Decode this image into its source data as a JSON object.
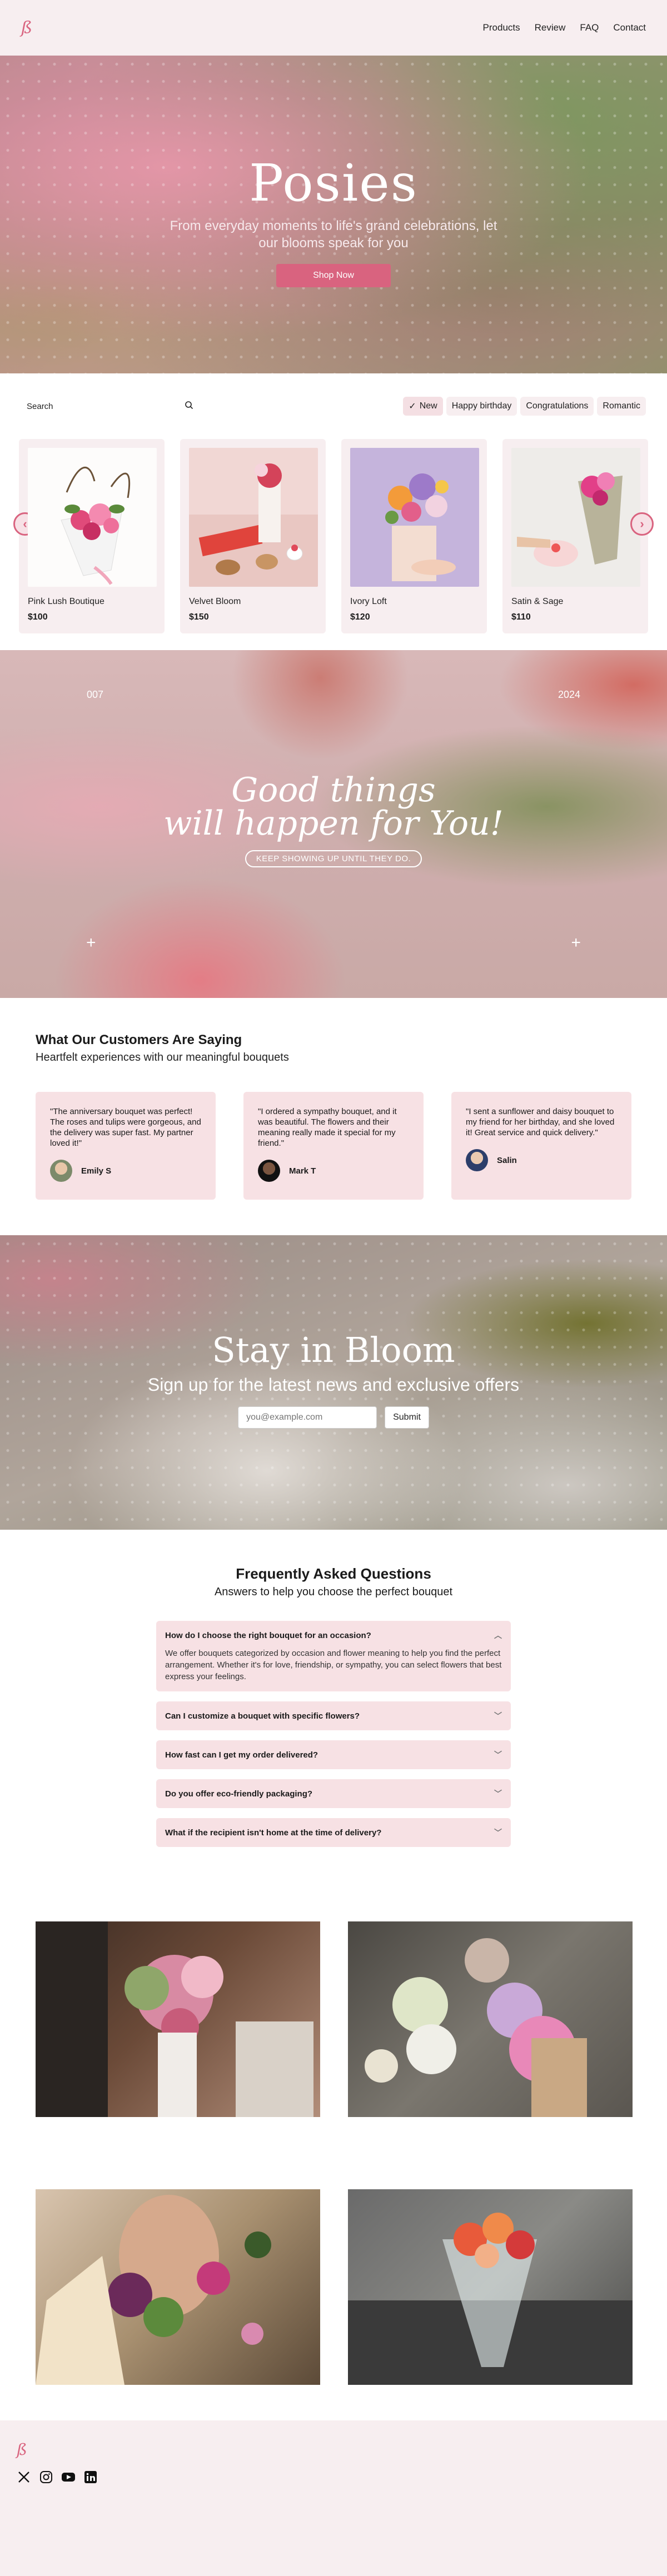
{
  "header": {
    "logo": "ß",
    "nav": [
      "Products",
      "Review",
      "FAQ",
      "Contact"
    ]
  },
  "hero": {
    "title": "Posies",
    "subtitle": "From everyday moments to life's grand celebrations, let our blooms speak for you",
    "cta": "Shop Now"
  },
  "filters": {
    "search_label": "Search",
    "chips": [
      "New",
      "Happy birthday",
      "Congratulations",
      "Romantic"
    ],
    "active_chip": "New"
  },
  "products": [
    {
      "name": "Pink Lush Boutique",
      "price": "$100"
    },
    {
      "name": "Velvet Bloom",
      "price": "$150"
    },
    {
      "name": "Ivory Loft",
      "price": "$120"
    },
    {
      "name": "Satin & Sage",
      "price": "$110"
    }
  ],
  "quote_banner": {
    "left_number": "007",
    "right_number": "2024",
    "line1": "Good things",
    "line2": "will happen for You!",
    "tagline": "KEEP SHOWING UP UNTIL THEY DO."
  },
  "testimonials": {
    "title": "What Our Customers Are Saying",
    "subtitle": "Heartfelt experiences with our meaningful bouquets",
    "items": [
      {
        "text": "\"The anniversary bouquet was perfect! The roses and tulips were gorgeous, and the delivery was super fast. My partner loved it!\"",
        "author": "Emily S"
      },
      {
        "text": "\"I ordered a sympathy bouquet, and it was beautiful. The flowers and their meaning really made it special for my friend.\"",
        "author": "Mark T"
      },
      {
        "text": "\"I sent a sunflower and daisy bouquet to my friend for her birthday, and she loved it! Great service and quick delivery.\"",
        "author": "Salin"
      }
    ]
  },
  "newsletter": {
    "title": "Stay in Bloom",
    "subtitle": "Sign up for the latest news and exclusive offers",
    "placeholder": "you@example.com",
    "submit": "Submit"
  },
  "faq": {
    "title": "Frequently Asked Questions",
    "subtitle": "Answers to help you choose the perfect bouquet",
    "items": [
      {
        "q": "How do I choose the right bouquet for an occasion?",
        "a": "We offer bouquets categorized by occasion and flower meaning to help you find the perfect arrangement. Whether it's for love, friendship, or sympathy, you can select flowers that best express your feelings.",
        "open": true
      },
      {
        "q": "Can I customize a bouquet with specific flowers?",
        "a": "",
        "open": false
      },
      {
        "q": "How fast can I get my order delivered?",
        "a": "",
        "open": false
      },
      {
        "q": "Do you offer eco-friendly packaging?",
        "a": "",
        "open": false
      },
      {
        "q": "What if the recipient isn't home at the time of delivery?",
        "a": "",
        "open": false
      }
    ]
  },
  "footer": {
    "logo": "ß",
    "socials": [
      "x-icon",
      "instagram-icon",
      "youtube-icon",
      "linkedin-icon"
    ]
  },
  "colors": {
    "accent": "#d9637f",
    "soft_pink": "#f7eef0",
    "card_pink": "#f7e1e4"
  }
}
